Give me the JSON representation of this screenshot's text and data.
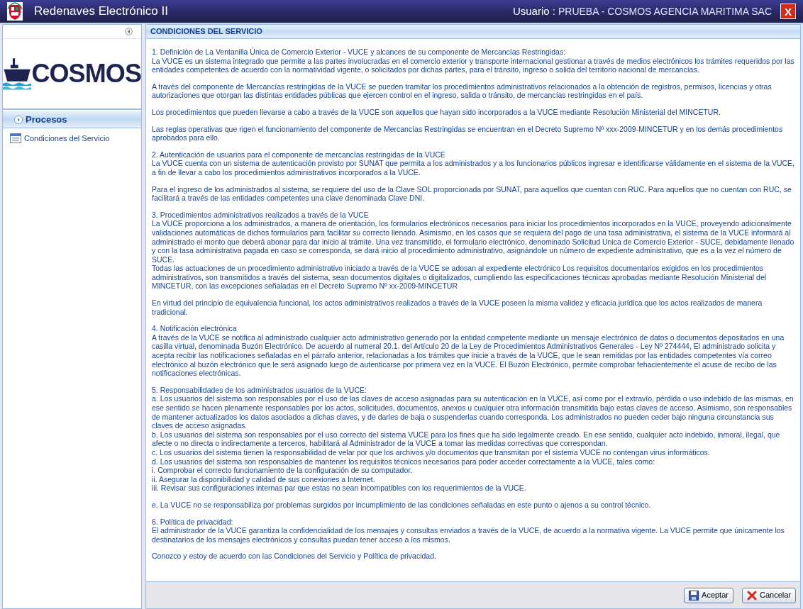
{
  "header": {
    "title": "Redenaves Electrónico II",
    "user_label": "Usuario :",
    "user_name": "PRUEBA - COSMOS AGENCIA MARITIMA SAC",
    "close": "X"
  },
  "sidebar": {
    "logo_text": "COSMOS",
    "section": "Procesos",
    "items": [
      {
        "label": "Condiciones del Servicio",
        "selected": false
      }
    ]
  },
  "panel": {
    "title": "CONDICIONES DEL SERVICIO",
    "blocks": [
      [
        "1. Definición de La Ventanilla Única de Comercio Exterior - VUCE y alcances de su componente de Mercancías Restringidas:",
        "La VUCE es un sistema integrado que permite a las partes involucradas en el comercio exterior y transporte internacional gestionar a través de medios electrónicos los trámites requeridos por las entidades competentes de acuerdo con la normatividad vigente, o solicitados por dichas partes, para el tránsito, ingreso o salida del territorio nacional de mercancías."
      ],
      [
        "A través del componente de Mercancías restringidas de la VUCE se pueden tramitar los procedimientos administrativos relacionados a la obtención de registros, permisos, licencias y otras autorizaciones que otorgan las distintas entidades públicas que ejercen control en el ingreso, salida o tránsito, de mercancías restringidas en el país."
      ],
      [
        "Los procedimientos que pueden llevarse a cabo a través de la VUCE son aquellos que hayan sido incorporados a la VUCE mediante Resolución Ministerial del MINCETUR."
      ],
      [
        "Las reglas operativas que rigen el funcionamiento del componente de Mercancías Restringidas se encuentran en el Decreto Supremo Nº xxx-2009-MINCETUR y en los demás procedimientos aprobados para ello."
      ],
      [
        "2. Autenticación de usuarios para el componente de mercancías restringidas de la VUCE",
        "La VUCE cuenta con un sistema de autenticación provisto por SUNAT que permita a los administrados y a los funcionarios públicos ingresar e identificarse válidamente en el sistema de la VUCE, a fin de llevar a cabo los procedimientos administrativos incorporados a la VUCE."
      ],
      [
        "Para el ingreso de los administrados al sistema, se requiere del uso de la Clave SOL proporcionada por SUNAT, para aquellos que cuentan con RUC. Para aquellos que no cuentan con RUC, se facilitará a través de las entidades competentes una clave denominada Clave DNI."
      ],
      [
        "3. Procedimientos administrativos realizados a través de la VUCE",
        "La VUCE proporciona a los administrados, a manera de orientación, los formularios electrónicos necesarios para iniciar los procedimientos incorporados en la VUCE, proveyendo adicionalmente validaciones automáticas de dichos formularios para facilitar su correcto llenado. Asimismo, en los casos que se requiera del pago de una tasa administrativa, el sistema de la VUCE informará al administrado el monto que deberá abonar para dar inicio al trámite. Una vez transmitido, el formulario electrónico, denominado Solicitud Unica de Comercio Exterior - SUCE, debidamente llenado y con la tasa administrativa pagada en caso se corresponda, se dará inicio al procedimiento administrativo, asignándole un número de expediente administrativo, que es a la vez el número de SUCE.",
        "Todas las actuaciones de un procedimiento administrativo iniciado a través de la VUCE se adosan al expediente electrónico Los requisitos documentarios exigidos en los procedimientos administrativos, son transmitidos a través del sistema, sean documentos digitales o digitalizados, cumpliendo las especificaciones técnicas aprobadas mediante Resolución Ministerial del MINCETUR, con las excepciones señaladas en el Decreto Supremo Nº xx-2009-MINCETUR"
      ],
      [
        "En virtud del principio de equivalencia funcional, los actos administrativos realizados a través de la VUCE poseen la misma validez y eficacia jurídica que los actos realizados de manera tradicional."
      ],
      [
        "4. Notificación electrónica",
        "A través de la VUCE se notifica al administrado cualquier acto administrativo generado por la entidad competente mediante un mensaje electrónico de datos o documentos depositados en una casilla virtual, denominada Buzón Electrónico. De acuerdo al numeral 20.1. del Artículo 20 de la Ley de Procedimientos Administrativos Generales - Ley Nº 274444, El administrado solicita y acepta recibir las notificaciones señaladas en el párrafo anterior, relacionadas a los trámites que inicie a través de la VUCE, que le sean remitidas por las entidades competentes vía correo electrónico al buzón electrónico que le será asignado luego de autenticarse por primera vez en la VUCE. El Buzón Electrónico, permite comprobar fehacientemente el acuse de recibo de las notificaciones electrónicas."
      ],
      [
        "5. Responsabilidades de los administrados usuarios de la VUCE:",
        "a. Los usuarios del sistema son responsables por el uso de las claves de acceso asignadas para su autenticación en la VUCE, así como por el extravío, pérdida o uso indebido de las mismas, en ese sentido se hacen plenamente responsables por los actos, solicitudes, documentos, anexos u cualquier otra información transmitida bajo estas claves de acceso. Asimismo, son responsables de mantener actualizados los datos asociados a dichas claves, y de darles de baja o suspenderlas cuando corresponda. Los administrados no pueden ceder bajo ninguna circunstancia sus claves de acceso asignadas.",
        "b. Los usuarios del sistema son responsables por el uso correcto del sistema VUCE para los fines que ha sido legalmente creado. En ese sentido, cualquier acto indebido, inmoral, ilegal, que afecte o no directa o indirectamente a terceros, habilitará al Administrador de la VUCE a tomar las medidas correctivas que correspondan.",
        "c. Los usuarios del sistema tienen la responsabilidad de velar por que los archivos y/o documentos que transmitan por el sistema VUCE no contengan virus informáticos.",
        "d. Los usuarios del sistema son responsables de mantener los requisitos técnicos necesarios para poder acceder correctamente a la VUCE, tales como:",
        "i. Comprobar el correcto funcionamiento de la configuración de su computador.",
        "ii. Asegurar la disponibilidad y calidad de sus conexiones a Internet.",
        "iii. Revisar sus configuraciones internas par que estas no sean incompatibles con los requerimientos de la VUCE."
      ],
      [
        "e. La VUCE no se responsabiliza por problemas surgidos por incumplimiento de las condiciones señaladas en este punto o ajenos a su control técnico."
      ],
      [
        "6. Política de privacidad:",
        "El administrador de la VUCE garantiza la confidencialidad de los mensajes y consultas enviados a través de la VUCE, de acuerdo a la normativa vigente. La VUCE permite que únicamente los destinatarios de los mensajes electrónicos y consultas puedan tener acceso a los mismos."
      ],
      [
        "Conozco y estoy de acuerdo con las Condiciones del Servicio y Política de privacidad."
      ]
    ]
  },
  "buttons": [
    {
      "label": "Aceptar",
      "kind": "accept"
    },
    {
      "label": "Cancelar",
      "kind": "cancel"
    }
  ]
}
